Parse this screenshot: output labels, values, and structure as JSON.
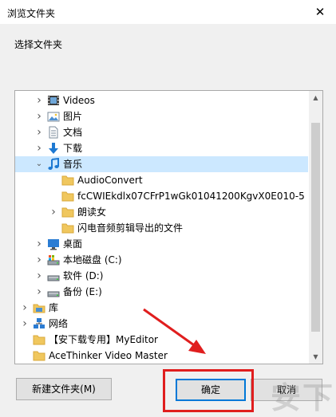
{
  "window": {
    "title": "浏览文件夹",
    "close_glyph": "✕"
  },
  "prompt": "选择文件夹",
  "tree": {
    "items": [
      {
        "label": "Videos",
        "icon": "videos-icon",
        "level": 1,
        "chevron": "right"
      },
      {
        "label": "图片",
        "icon": "pictures-icon",
        "level": 1,
        "chevron": "right"
      },
      {
        "label": "文档",
        "icon": "documents-icon",
        "level": 1,
        "chevron": "right"
      },
      {
        "label": "下载",
        "icon": "download-icon",
        "level": 1,
        "chevron": "right"
      },
      {
        "label": "音乐",
        "icon": "music-icon",
        "level": 1,
        "chevron": "down",
        "selected": true
      },
      {
        "label": "AudioConvert",
        "icon": "folder-icon",
        "level": 2,
        "chevron": ""
      },
      {
        "label": "fcCWIEkdlx07CFrP1wGk01041200KgvX0E010-5",
        "icon": "folder-icon",
        "level": 2,
        "chevron": ""
      },
      {
        "label": "朗读女",
        "icon": "folder-icon",
        "level": 2,
        "chevron": "right"
      },
      {
        "label": "闪电音频剪辑导出的文件",
        "icon": "folder-icon",
        "level": 2,
        "chevron": ""
      },
      {
        "label": "桌面",
        "icon": "desktop-icon",
        "level": 1,
        "chevron": "right"
      },
      {
        "label": "本地磁盘 (C:)",
        "icon": "drive-c-icon",
        "level": 1,
        "chevron": "right"
      },
      {
        "label": "软件 (D:)",
        "icon": "drive-icon",
        "level": 1,
        "chevron": "right"
      },
      {
        "label": "备份 (E:)",
        "icon": "drive-icon",
        "level": 1,
        "chevron": "right"
      },
      {
        "label": "库",
        "icon": "library-icon",
        "level": 0,
        "chevron": "right"
      },
      {
        "label": "网络",
        "icon": "network-icon",
        "level": 0,
        "chevron": "right"
      },
      {
        "label": "【安下载专用】MyEditor",
        "icon": "folder-icon",
        "level": 0,
        "chevron": ""
      },
      {
        "label": "AceThinker Video Master",
        "icon": "folder-icon",
        "level": 0,
        "chevron": ""
      }
    ]
  },
  "buttons": {
    "new_folder": "新建文件夹(M)",
    "ok": "确定",
    "cancel": "取消"
  },
  "colors": {
    "selection": "#cce8ff",
    "accent": "#0078d7",
    "annotation": "#e01e1e",
    "folder": "#f0c75e"
  }
}
